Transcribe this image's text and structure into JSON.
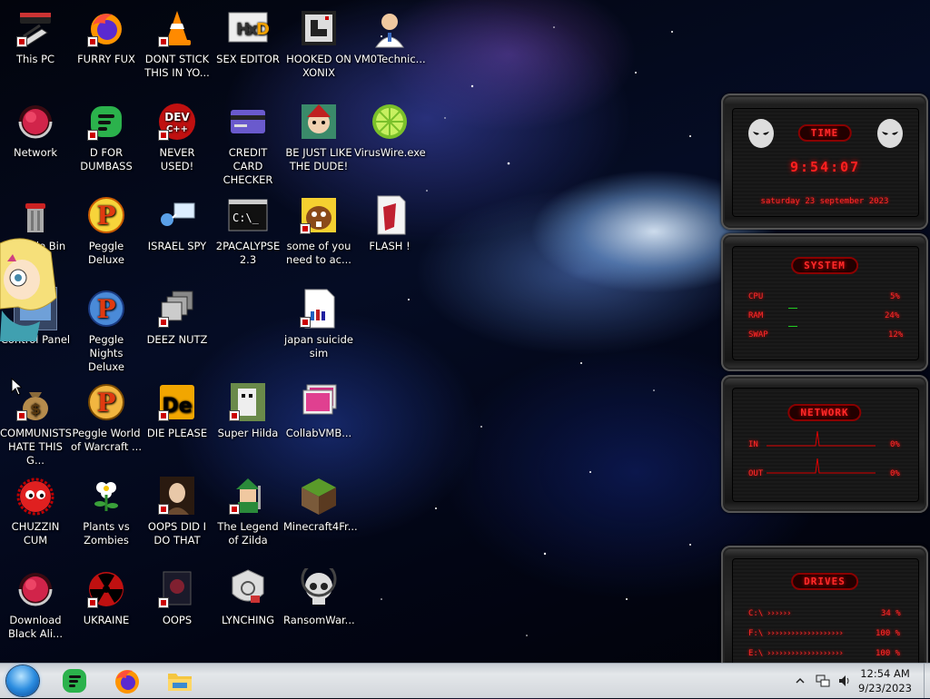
{
  "desktop": {
    "icons": [
      {
        "label": "This PC"
      },
      {
        "label": "FURRY FUX"
      },
      {
        "label": "DONT STICK THIS IN YO..."
      },
      {
        "label": "SEX EDITOR"
      },
      {
        "label": "HOOKED ON XONIX"
      },
      {
        "label": "VM0Technic..."
      },
      {
        "label": "Network"
      },
      {
        "label": "D FOR DUMBASS"
      },
      {
        "label": "NEVER USED!"
      },
      {
        "label": "CREDIT CARD CHECKER"
      },
      {
        "label": "BE JUST LIKE THE DUDE!"
      },
      {
        "label": "VirusWire.exe"
      },
      {
        "label": "Recycle Bin"
      },
      {
        "label": "Peggle Deluxe"
      },
      {
        "label": "ISRAEL SPY"
      },
      {
        "label": "2PACALYPSE 2.3"
      },
      {
        "label": "some of you need to ac..."
      },
      {
        "label": "FLASH !"
      },
      {
        "label": "Control Panel"
      },
      {
        "label": "Peggle Nights Deluxe"
      },
      {
        "label": "DEEZ NUTZ"
      },
      {
        "label": "japan suicide sim"
      },
      {
        "label": "COMMUNISTS HATE THIS G..."
      },
      {
        "label": "Peggle World of Warcraft ..."
      },
      {
        "label": "DIE PLEASE"
      },
      {
        "label": "Super Hilda"
      },
      {
        "label": "CollabVMB..."
      },
      {
        "label": "CHUZZIN CUM"
      },
      {
        "label": "Plants vs Zombies"
      },
      {
        "label": "OOPS DID I DO THAT"
      },
      {
        "label": "The Legend of Zilda"
      },
      {
        "label": "Minecraft4Fr..."
      },
      {
        "label": "Download Black Ali..."
      },
      {
        "label": "UKRAINE"
      },
      {
        "label": "OOPS"
      },
      {
        "label": "LYNCHING"
      },
      {
        "label": "RansomWar..."
      }
    ]
  },
  "widgets": {
    "time": {
      "title": "TIME",
      "clock": "9:54:07",
      "date": "saturday 23 september 2023"
    },
    "system": {
      "title": "SYSTEM",
      "rows": [
        {
          "label": "CPU",
          "value": "5%"
        },
        {
          "label": "RAM",
          "value": "24%"
        },
        {
          "label": "SWAP",
          "value": "12%"
        }
      ]
    },
    "network": {
      "title": "NETWORK",
      "rows": [
        {
          "label": "IN",
          "value": "0%"
        },
        {
          "label": "OUT",
          "value": "0%"
        }
      ]
    },
    "drives": {
      "title": "DRIVES",
      "rows": [
        {
          "label": "C:\\",
          "value": "34 %"
        },
        {
          "label": "F:\\",
          "value": "100 %"
        },
        {
          "label": "E:\\",
          "value": "100 %"
        }
      ]
    }
  },
  "taskbar": {
    "pinned": [
      {
        "name": "feedly-icon"
      },
      {
        "name": "firefox-icon"
      },
      {
        "name": "file-explorer-icon"
      }
    ],
    "clock": {
      "time": "12:54 AM",
      "date": "9/23/2023"
    }
  },
  "colors": {
    "widget_red": "#ff2a2a",
    "taskbar": "#dfe2e6"
  }
}
